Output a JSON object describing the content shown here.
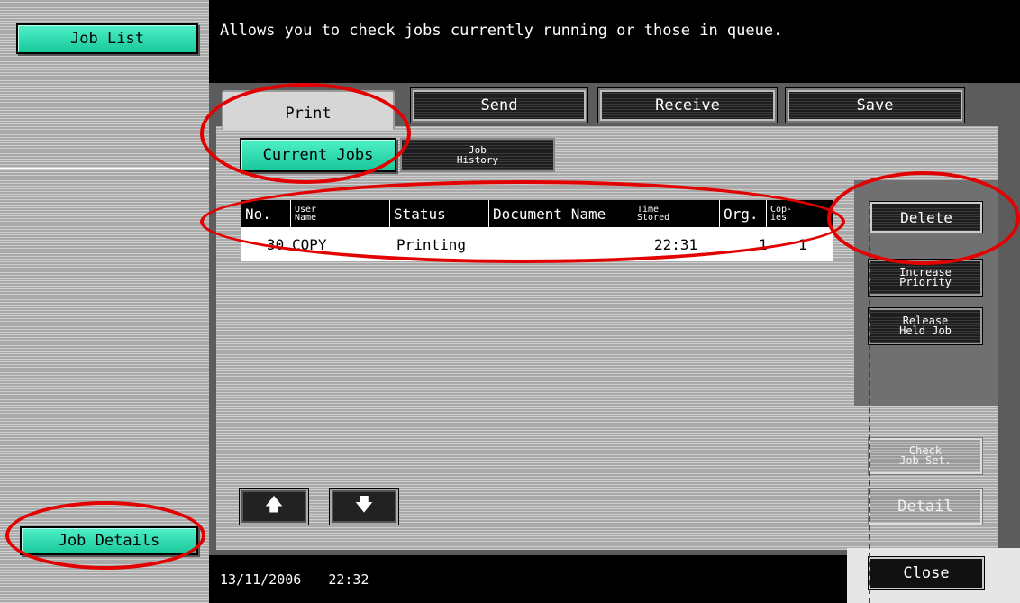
{
  "sidebar": {
    "job_list_label": "Job List",
    "job_details_label": "Job Details"
  },
  "header": {
    "description": "Allows you to check jobs currently running or those in queue."
  },
  "tabs": [
    {
      "label": "Print",
      "active": true
    },
    {
      "label": "Send",
      "active": false
    },
    {
      "label": "Receive",
      "active": false
    },
    {
      "label": "Save",
      "active": false
    }
  ],
  "subtabs": {
    "current_jobs": "Current Jobs",
    "job_history_line1": "Job",
    "job_history_line2": "History"
  },
  "table": {
    "columns": {
      "no": "No.",
      "user_name_1": "User",
      "user_name_2": "Name",
      "status": "Status",
      "document_name": "Document Name",
      "time_stored_1": "Time",
      "time_stored_2": "Stored",
      "org": "Org.",
      "copies_1": "Cop-",
      "copies_2": "ies"
    },
    "rows": [
      {
        "no": "30",
        "user_name": "COPY",
        "status": "Printing",
        "document_name": "",
        "time_stored": "22:31",
        "org": "1",
        "copies": "1"
      }
    ]
  },
  "actions": {
    "delete": "Delete",
    "increase_priority_1": "Increase",
    "increase_priority_2": "Priority",
    "release_held_1": "Release",
    "release_held_2": "Held Job",
    "check_job_set_1": "Check",
    "check_job_set_2": "Job Set.",
    "detail": "Detail",
    "close": "Close"
  },
  "footer": {
    "date": "13/11/2006",
    "time": "22:32"
  },
  "colors": {
    "accent_green": "#19c79a",
    "annotation_red": "#e30000"
  }
}
